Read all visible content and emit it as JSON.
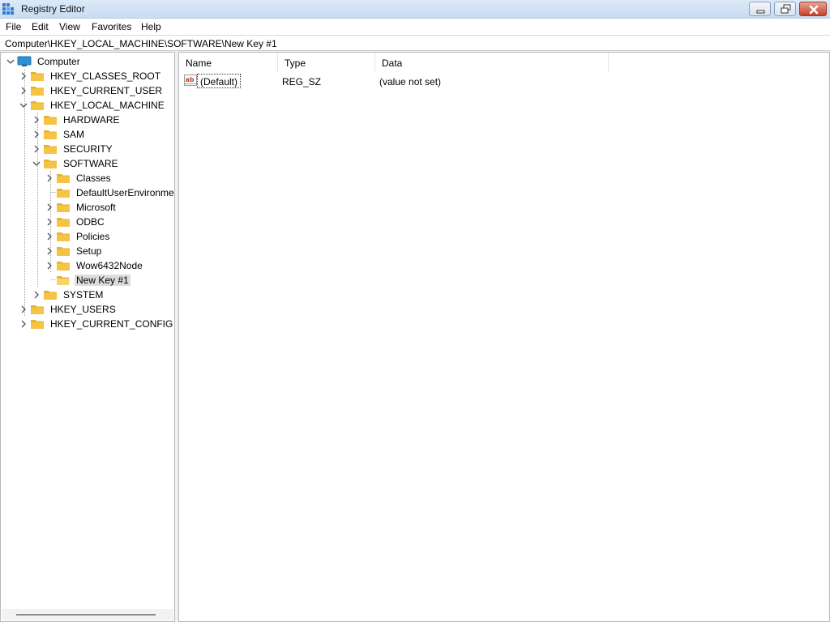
{
  "window": {
    "title": "Registry Editor"
  },
  "menu": {
    "items": [
      "File",
      "Edit",
      "View",
      "Favorites",
      "Help"
    ]
  },
  "address": {
    "path": "Computer\\HKEY_LOCAL_MACHINE\\SOFTWARE\\New Key #1"
  },
  "tree": {
    "items": [
      {
        "label": "Computer",
        "level": 0,
        "state": "expanded",
        "icon": "computer-icon"
      },
      {
        "label": "HKEY_CLASSES_ROOT",
        "level": 1,
        "state": "collapsed",
        "icon": "folder-icon"
      },
      {
        "label": "HKEY_CURRENT_USER",
        "level": 1,
        "state": "collapsed",
        "icon": "folder-icon"
      },
      {
        "label": "HKEY_LOCAL_MACHINE",
        "level": 1,
        "state": "expanded",
        "icon": "folder-icon"
      },
      {
        "label": "HARDWARE",
        "level": 2,
        "state": "collapsed",
        "icon": "folder-icon"
      },
      {
        "label": "SAM",
        "level": 2,
        "state": "collapsed",
        "icon": "folder-icon"
      },
      {
        "label": "SECURITY",
        "level": 2,
        "state": "collapsed",
        "icon": "folder-icon"
      },
      {
        "label": "SOFTWARE",
        "level": 2,
        "state": "expanded",
        "icon": "folder-icon"
      },
      {
        "label": "Classes",
        "level": 3,
        "state": "collapsed",
        "icon": "folder-icon"
      },
      {
        "label": "DefaultUserEnvironmen",
        "level": 3,
        "state": "leaf",
        "icon": "folder-icon"
      },
      {
        "label": "Microsoft",
        "level": 3,
        "state": "collapsed",
        "icon": "folder-icon"
      },
      {
        "label": "ODBC",
        "level": 3,
        "state": "collapsed",
        "icon": "folder-icon"
      },
      {
        "label": "Policies",
        "level": 3,
        "state": "collapsed",
        "icon": "folder-icon"
      },
      {
        "label": "Setup",
        "level": 3,
        "state": "collapsed",
        "icon": "folder-icon"
      },
      {
        "label": "Wow6432Node",
        "level": 3,
        "state": "collapsed",
        "icon": "folder-icon"
      },
      {
        "label": "New Key #1",
        "level": 3,
        "state": "leaf",
        "selected": true,
        "icon": "folder-open-icon"
      },
      {
        "label": "SYSTEM",
        "level": 2,
        "state": "collapsed",
        "icon": "folder-icon"
      },
      {
        "label": "HKEY_USERS",
        "level": 1,
        "state": "collapsed",
        "icon": "folder-icon"
      },
      {
        "label": "HKEY_CURRENT_CONFIG",
        "level": 1,
        "state": "collapsed",
        "icon": "folder-icon"
      }
    ]
  },
  "list": {
    "columns": [
      "Name",
      "Type",
      "Data"
    ],
    "rows": [
      {
        "icon": "string-value-icon",
        "name": "(Default)",
        "type": "REG_SZ",
        "data": "(value not set)"
      }
    ]
  },
  "colors": {
    "folder": "#f5c445",
    "selection": "#dcdcdc",
    "computer": "#2f8fd8"
  }
}
